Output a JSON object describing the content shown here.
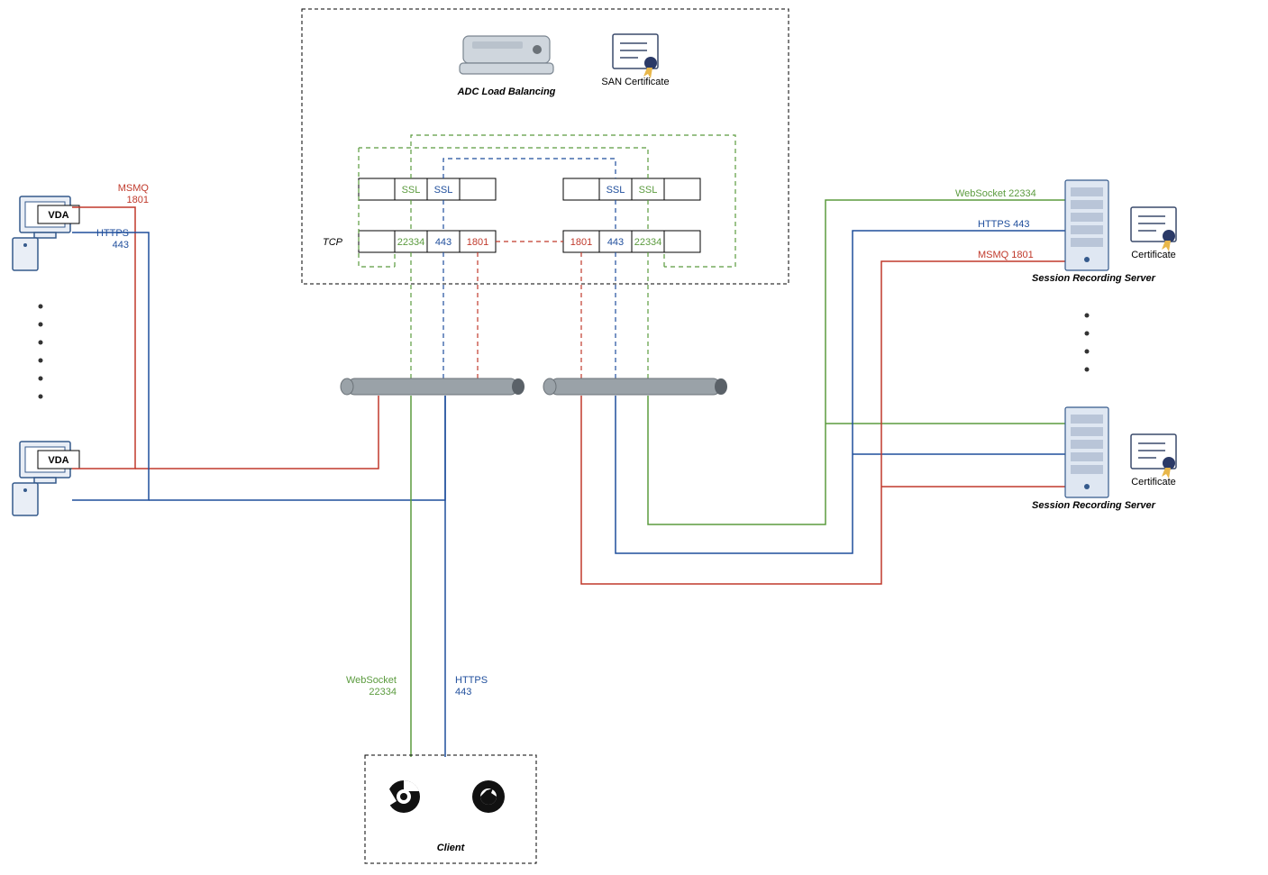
{
  "adc": {
    "title": "ADC Load Balancing",
    "san_cert": "SAN Certificate",
    "tcp": "TCP"
  },
  "ssl": {
    "a1": "SSL",
    "a2": "SSL",
    "b1": "SSL",
    "b2": "SSL"
  },
  "ports": {
    "a_22334": "22334",
    "a_443": "443",
    "a_1801": "1801",
    "b_1801": "1801",
    "b_443": "443",
    "b_22334": "22334"
  },
  "vda": {
    "top": "VDA",
    "bottom": "VDA"
  },
  "left_labels": {
    "msmq": "MSMQ",
    "msmq_port": "1801",
    "https": "HTTPS",
    "https_port": "443"
  },
  "client": {
    "label": "Client",
    "ws": "WebSocket",
    "ws_port": "22334",
    "https": "HTTPS",
    "https_port": "443"
  },
  "right_labels": {
    "ws": "WebSocket  22334",
    "https": "HTTPS  443",
    "msmq": "MSMQ  1801",
    "cert1": "Certificate",
    "cert2": "Certificate",
    "srs1": "Session Recording Server",
    "srs2": "Session Recording Server"
  }
}
